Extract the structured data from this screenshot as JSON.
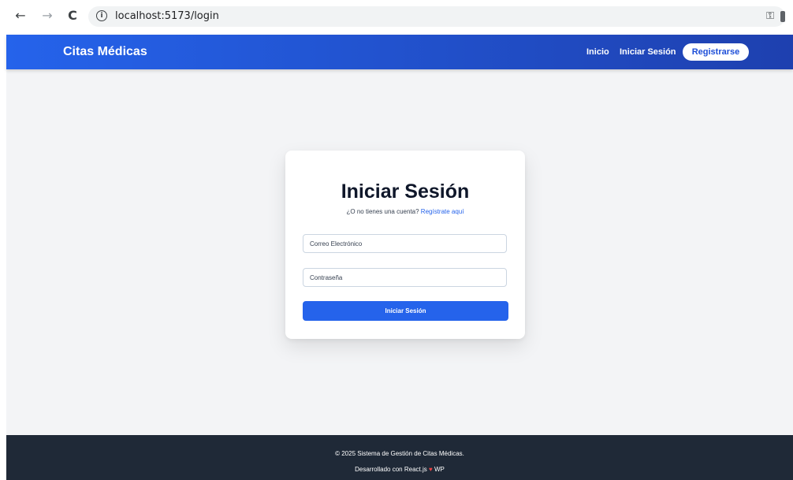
{
  "browser": {
    "url": "localhost:5173/login",
    "back_icon": "←",
    "forward_icon": "→",
    "reload_icon": "C"
  },
  "header": {
    "brand": "Citas Médicas",
    "nav": {
      "inicio": "Inicio",
      "iniciar_sesion": "Iniciar Sesión",
      "registrarse": "Registrarse"
    }
  },
  "login": {
    "title": "Iniciar Sesión",
    "subtitle_prefix": "¿O no tienes una cuenta?",
    "subtitle_link": "Regístrate aquí",
    "email_placeholder": "Correo Electrónico",
    "password_placeholder": "Contraseña",
    "submit_label": "Iniciar Sesión"
  },
  "footer": {
    "line1": "© 2025 Sistema de Gestión de Citas Médicas.",
    "line2_prefix": "Desarrollado con React.js",
    "line2_suffix": "WP"
  },
  "colors": {
    "primary": "#2563eb",
    "header_end": "#1e40af",
    "page_bg": "#f3f4f6",
    "footer_bg": "#1f2937",
    "heart": "#ef4444"
  }
}
